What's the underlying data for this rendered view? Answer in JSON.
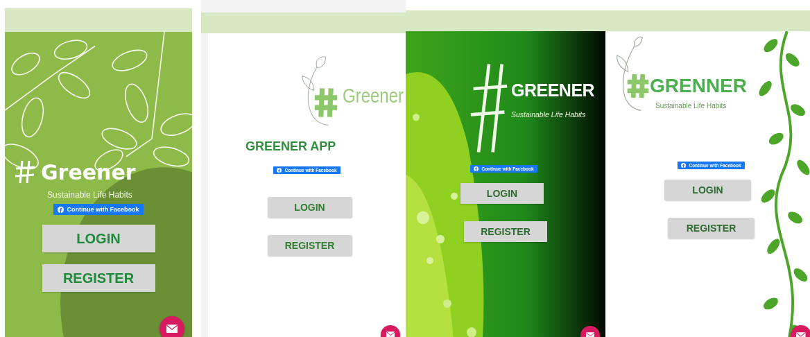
{
  "screens": [
    {
      "kind": "leaves",
      "logo": {
        "title": "Greener",
        "tagline": "Sustainable Life Habits"
      },
      "facebook_button": "Continue with Facebook",
      "buttons": [
        "LOGIN",
        "REGISTER"
      ]
    },
    {
      "kind": "plain",
      "logo": {
        "title": "Greener"
      },
      "heading": "GREENER APP",
      "facebook_button": "Continue with Facebook",
      "buttons": [
        "LOGIN",
        "REGISTER"
      ]
    },
    {
      "logo": {
        "title": "GREENER",
        "tagline": "Sustainable Life Habits"
      },
      "facebook_button": "Continue with Facebook",
      "buttons": [
        "LOGIN",
        "REGISTER"
      ]
    },
    {
      "kind": "vines",
      "logo": {
        "title": "GRENNER",
        "tagline": "Sustainable Life Habits"
      },
      "facebook_button": "Continue with Facebook",
      "buttons": [
        "LOGIN",
        "REGISTER"
      ]
    }
  ]
}
